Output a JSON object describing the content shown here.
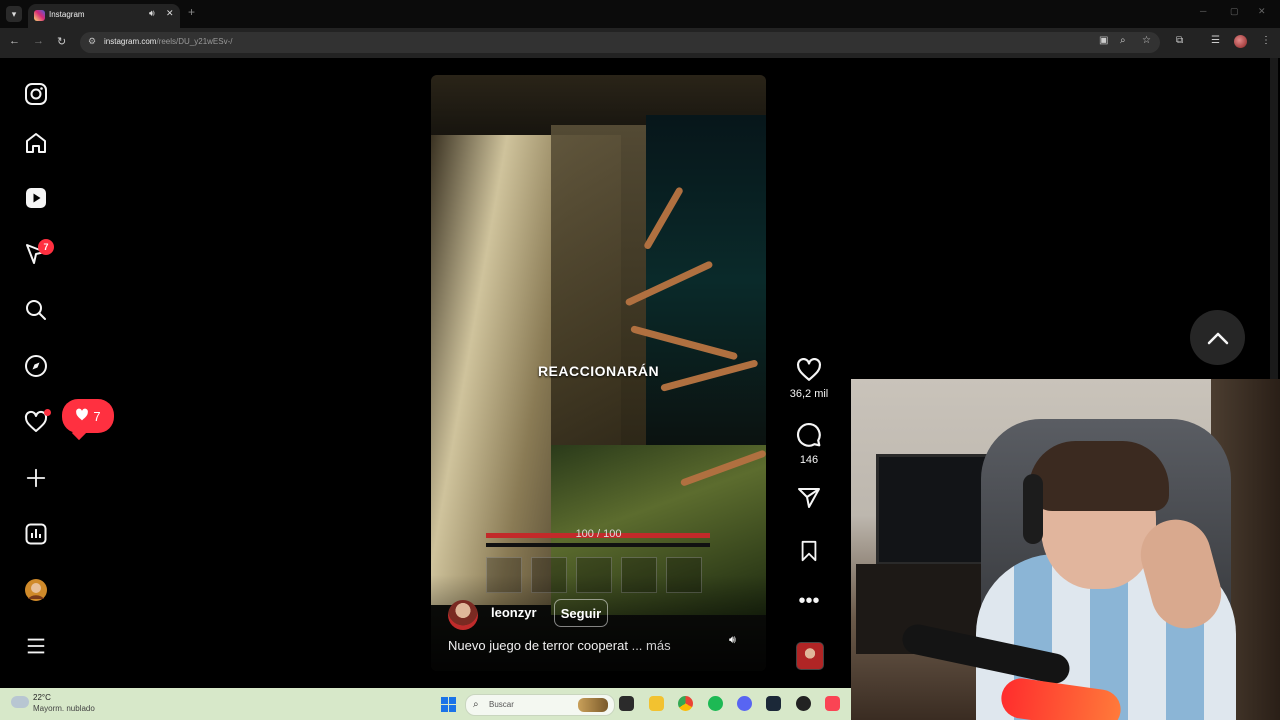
{
  "browser": {
    "tab_title": "Instagram",
    "url_host": "instagram.com",
    "url_path": "/reels/DU_y21wESv-/",
    "new_tab_symbol": "+",
    "icons": [
      "tab-menu-icon",
      "speaker-icon",
      "close-icon",
      "back-icon",
      "forward-icon",
      "reload-icon",
      "site-info-icon",
      "cast-icon",
      "zoom-icon",
      "bookmark-star-icon",
      "extensions-icon",
      "reading-list-icon",
      "profile-icon",
      "menu-icon"
    ]
  },
  "sidebar": {
    "items": [
      {
        "name": "instagram-logo"
      },
      {
        "name": "home"
      },
      {
        "name": "reels"
      },
      {
        "name": "messages",
        "badge": "7"
      },
      {
        "name": "search"
      },
      {
        "name": "explore"
      },
      {
        "name": "notifications",
        "popup_count": "7"
      },
      {
        "name": "create"
      },
      {
        "name": "dashboard"
      },
      {
        "name": "profile"
      },
      {
        "name": "more"
      }
    ]
  },
  "reel": {
    "overlay_text": "REACCIONARÁN",
    "health_text": "100 / 100",
    "health_fraction": 1.0,
    "hotbar_slots": 5,
    "username": "leonzyr",
    "follow_label": "Seguir",
    "description": "Nuevo juego de terror cooperat",
    "more_label": "... más"
  },
  "actions": {
    "likes": "36,2 mil",
    "comments": "146"
  },
  "taskbar": {
    "temperature": "22°C",
    "weather": "Mayorm. nublado",
    "search_placeholder": "Buscar"
  },
  "colors": {
    "badge_red": "#ff3040",
    "taskbar_bg": "#d7e8c9",
    "page_bg": "#000000"
  }
}
